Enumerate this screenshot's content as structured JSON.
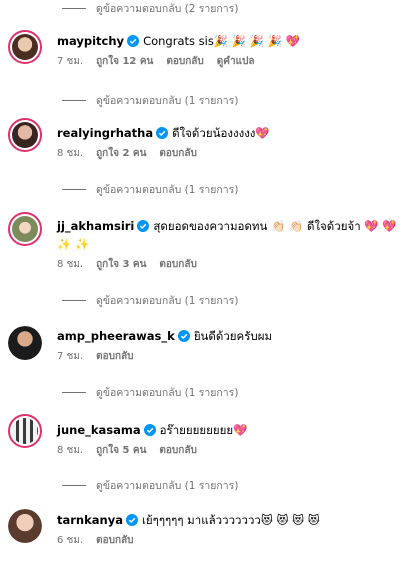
{
  "view_replies_top": "ดูข้อความตอบกลับ (2 รายการ)",
  "comments": [
    {
      "username": "maypitchy",
      "text": "Congrats sis🎉 🎉 🎉 🎉 💖",
      "time": "7 ชม.",
      "likes": "ถูกใจ 12 คน",
      "reply": "ตอบกลับ",
      "translate": "ดูคำแปล",
      "view_replies": "ดูข้อความตอบกลับ (1 รายการ)"
    },
    {
      "username": "realyingrhatha",
      "text": "ดีใจด้วยน้องงงงง💖",
      "time": "8 ชม.",
      "likes": "ถูกใจ 2 คน",
      "reply": "ตอบกลับ",
      "view_replies": "ดูข้อความตอบกลับ (1 รายการ)"
    },
    {
      "username": "jj_akhamsiri",
      "text": "สุดยอดของความอดทน 👏🏻 👏🏻 ดีใจด้วยจ้า 💖 💖 ✨ ✨",
      "time": "8 ชม.",
      "likes": "ถูกใจ 3 คน",
      "reply": "ตอบกลับ",
      "view_replies": "ดูข้อความตอบกลับ (1 รายการ)"
    },
    {
      "username": "amp_pheerawas_k",
      "text": "ยินดีด้วยครับผม",
      "time": "7 ชม.",
      "reply": "ตอบกลับ",
      "view_replies": "ดูข้อความตอบกลับ (1 รายการ)"
    },
    {
      "username": "june_kasama",
      "text": "อร๊ายยยยยยยย💖",
      "time": "8 ชม.",
      "likes": "ถูกใจ 5 คน",
      "reply": "ตอบกลับ",
      "view_replies": "ดูข้อความตอบกลับ (1 รายการ)"
    },
    {
      "username": "tarnkanya",
      "text": "เย้ๆๆๆๆๆ มาแล้ววววววว😻 😻 😻 😻",
      "time": "6 ชม.",
      "reply": "ตอบกลับ"
    }
  ],
  "colors": {
    "verified": "#0095f6",
    "meta": "#737373",
    "story_ring": "#e1306c"
  }
}
